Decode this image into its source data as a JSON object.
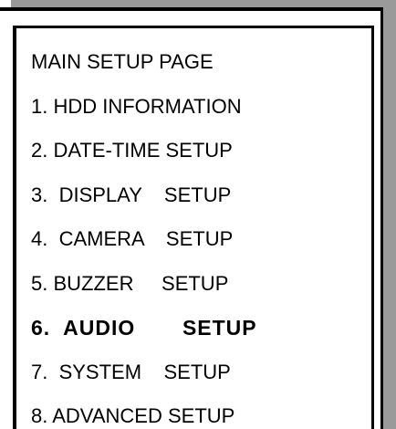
{
  "menu": {
    "title": "MAIN SETUP PAGE",
    "items": [
      {
        "label": "1. HDD INFORMATION"
      },
      {
        "label": "2. DATE-TIME SETUP"
      },
      {
        "label": "3.  DISPLAY    SETUP"
      },
      {
        "label": "4.  CAMERA    SETUP"
      },
      {
        "label": "5. BUZZER     SETUP"
      },
      {
        "label": "6.  AUDIO       SETUP",
        "selected": true
      },
      {
        "label": "7.  SYSTEM    SETUP"
      },
      {
        "label": "8. ADVANCED SETUP"
      }
    ]
  },
  "colors": {
    "background": "#ffffff",
    "text": "#000000",
    "border": "#000000",
    "shadow": "#9a9a9a"
  }
}
